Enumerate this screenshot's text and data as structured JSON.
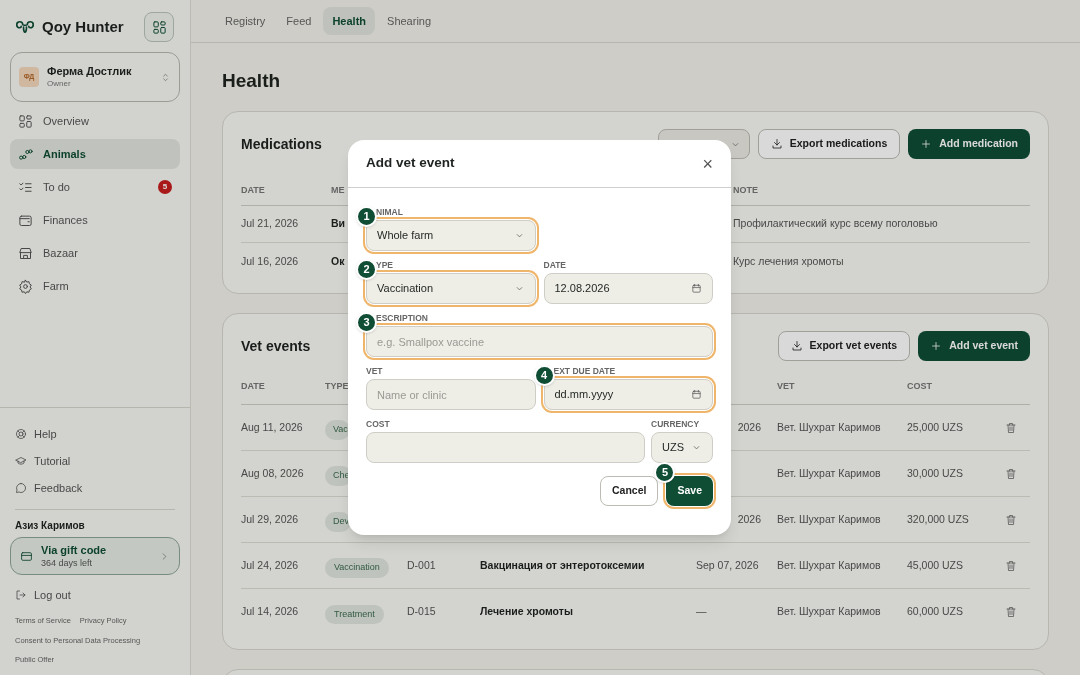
{
  "sidebar": {
    "brand": "Qoy Hunter",
    "farm": {
      "initials": "ФД",
      "name": "Ферма Достлик",
      "role": "Owner"
    },
    "nav": [
      {
        "label": "Overview",
        "selected": false
      },
      {
        "label": "Animals",
        "selected": true
      },
      {
        "label": "To do",
        "selected": false,
        "badge": "5"
      },
      {
        "label": "Finances",
        "selected": false
      },
      {
        "label": "Bazaar",
        "selected": false
      },
      {
        "label": "Farm",
        "selected": false
      }
    ],
    "help_links": [
      {
        "label": "Help"
      },
      {
        "label": "Tutorial"
      },
      {
        "label": "Feedback"
      }
    ],
    "user": "Азиз Каримов",
    "plan": {
      "title": "Via gift code",
      "subtitle": "364 days left"
    },
    "logout": "Log out",
    "legal_links": [
      "Terms of Service",
      "Privacy Policy",
      "Consent to Personal Data Processing",
      "Public Offer"
    ]
  },
  "tabs": [
    {
      "label": "Registry",
      "selected": false
    },
    {
      "label": "Feed",
      "selected": false
    },
    {
      "label": "Health",
      "selected": true
    },
    {
      "label": "Shearing",
      "selected": false
    }
  ],
  "page_title": "Health",
  "medications": {
    "title": "Medications",
    "buttons": [
      {
        "label": "Export medications",
        "kind": "export"
      },
      {
        "label": "Add medication",
        "kind": "add"
      }
    ],
    "columns": [
      "DATE",
      "МЕ",
      "NOTE"
    ],
    "rows": [
      {
        "date": "Jul 21, 2026",
        "medication": "Ви",
        "note": "Профилактический курс всему поголовью"
      },
      {
        "date": "Jul 16, 2026",
        "medication": "Ок",
        "note": "Курс лечения хромоты"
      }
    ]
  },
  "vet_events": {
    "title": "Vet events",
    "buttons": [
      {
        "label": "Export vet events",
        "kind": "export"
      },
      {
        "label": "Add vet event",
        "kind": "add"
      }
    ],
    "columns": [
      "DATE",
      "TYPE",
      "VET",
      "COST"
    ],
    "rows": [
      {
        "date": "Aug 11, 2026",
        "type": "Vac",
        "next_due": "2026",
        "vet": "Вет. Шухрат Каримов",
        "cost": "25,000 UZS"
      },
      {
        "date": "Aug 08, 2026",
        "type": "Che",
        "vet": "Вет. Шухрат Каримов",
        "cost": "30,000 UZS"
      },
      {
        "date": "Jul 29, 2026",
        "type": "Dev",
        "next_due": "2026",
        "vet": "Вет. Шухрат Каримов",
        "cost": "320,000 UZS"
      },
      {
        "date": "Jul 24, 2026",
        "type": "Vaccination",
        "animal": "D-001",
        "description": "Вакцинация от энтеротоксемии",
        "next_due": "Sep 07, 2026",
        "vet": "Вет. Шухрат Каримов",
        "cost": "45,000 UZS"
      },
      {
        "date": "Jul 14, 2026",
        "type": "Treatment",
        "animal": "D-015",
        "description": "Лечение хромоты",
        "next_due": "—",
        "vet": "Вет. Шухрат Каримов",
        "cost": "60,000 UZS"
      }
    ]
  },
  "modal": {
    "title": "Add vet event",
    "close": "×",
    "rows": [
      {
        "fields": [
          {
            "kind": "select",
            "label": "NIMAL",
            "value": "Whole farm",
            "step": "1"
          }
        ]
      },
      {
        "fields": [
          {
            "kind": "select",
            "label": "YPE",
            "value": "Vaccination",
            "step": "2"
          },
          {
            "kind": "date",
            "label": "DATE",
            "value": "12.08.2026"
          }
        ]
      },
      {
        "fields": [
          {
            "kind": "text",
            "label": "ESCRIPTION",
            "placeholder": "e.g. Smallpox vaccine",
            "step": "3"
          }
        ]
      },
      {
        "fields": [
          {
            "kind": "text",
            "label": "VET",
            "placeholder": "Name or clinic"
          },
          {
            "kind": "date",
            "label": "EXT DUE DATE",
            "value": "dd.mm.yyyy",
            "step": "4"
          }
        ]
      },
      {
        "fields": [
          {
            "kind": "text",
            "label": "COST"
          },
          {
            "kind": "select",
            "label": "CURRENCY",
            "value": "UZS"
          }
        ]
      }
    ],
    "actions": [
      {
        "label": "Cancel",
        "kind": "secondary"
      },
      {
        "label": "Save",
        "kind": "primary",
        "step": "5"
      }
    ]
  }
}
